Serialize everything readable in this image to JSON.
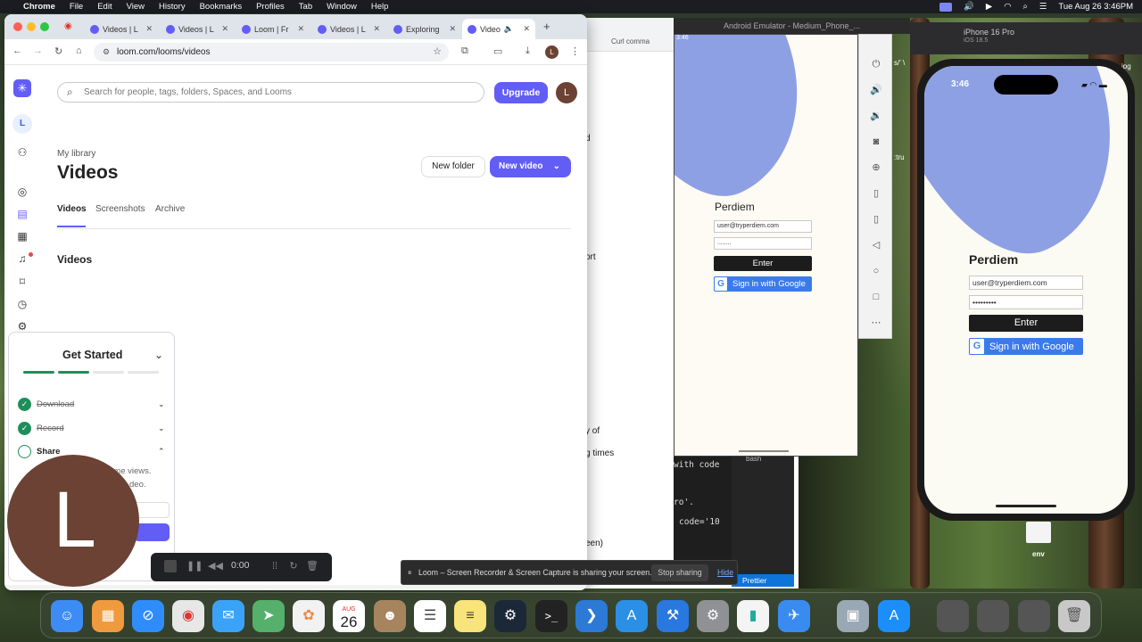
{
  "menubar": {
    "items": [
      "Chrome",
      "File",
      "Edit",
      "View",
      "History",
      "Bookmarks",
      "Profiles",
      "Tab",
      "Window",
      "Help"
    ],
    "datetime": "Tue Aug 26  3:46PM"
  },
  "chrome": {
    "tabs": [
      "Videos | L",
      "Videos | L",
      "Loom | Fr",
      "Videos | L",
      "Exploring",
      "Video"
    ],
    "active_tab_index": 5,
    "url": "loom.com/looms/videos",
    "profile_initial": "L"
  },
  "loom": {
    "sidebar_avatar": "L",
    "search_placeholder": "Search for people, tags, folders, Spaces, and Looms",
    "upgrade_label": "Upgrade",
    "user_initial": "L",
    "library_label": "My library",
    "page_title": "Videos",
    "new_folder_label": "New folder",
    "new_video_label": "New video",
    "tabs": [
      "Videos",
      "Screenshots",
      "Archive"
    ],
    "section_title": "Videos"
  },
  "get_started": {
    "title": "Get Started",
    "progress_done": 2,
    "progress_total": 4,
    "steps": [
      {
        "label": "Download",
        "done": true
      },
      {
        "label": "Record",
        "done": true
      },
      {
        "label": "Share",
        "done": false
      }
    ],
    "share_partial_1": "ome views.",
    "share_partial_2": "deo."
  },
  "recorder": {
    "camera_initial": "L",
    "time": "0:00"
  },
  "share_notice": {
    "text": "Loom – Screen Recorder & Screen Capture is sharing your screen.",
    "stop_label": "Stop sharing",
    "hide_label": "Hide"
  },
  "android": {
    "window_title": "Android Emulator - Medium_Phone_...",
    "status_time": "3:46",
    "app_title": "Perdiem",
    "email": "user@tryperdiem.com",
    "password_mask": "........",
    "enter_label": "Enter",
    "google_label": "Sign in with Google"
  },
  "iphone": {
    "device_name": "iPhone 16 Pro",
    "os_version": "iOS 18.5",
    "status_time": "3:46",
    "app_title": "Perdiem",
    "email": "user@tryperdiem.com",
    "password_mask": "•••••••••",
    "enter_label": "Enter",
    "google_label": "Sign in with Google"
  },
  "editor": {
    "snippets": [
      "d",
      "ort",
      "y of",
      "g times",
      "een)",
      "ipg",
      "s/' \\",
      ":tru"
    ],
    "terminal_lines": [
      "with code",
      "ro'.",
      "code='10"
    ],
    "tab_label": "Curl comma",
    "terminal_tab": "bash",
    "status_label": "Prettier"
  },
  "desktop": {
    "folder_label": "env",
    "dock_date_month": "AUG",
    "dock_date_day": "26"
  },
  "colors": {
    "loom_accent": "#625df5",
    "android_blob": "#8ea0e4",
    "google_blue": "#3b7be9",
    "check_green": "#1e8f5a"
  }
}
